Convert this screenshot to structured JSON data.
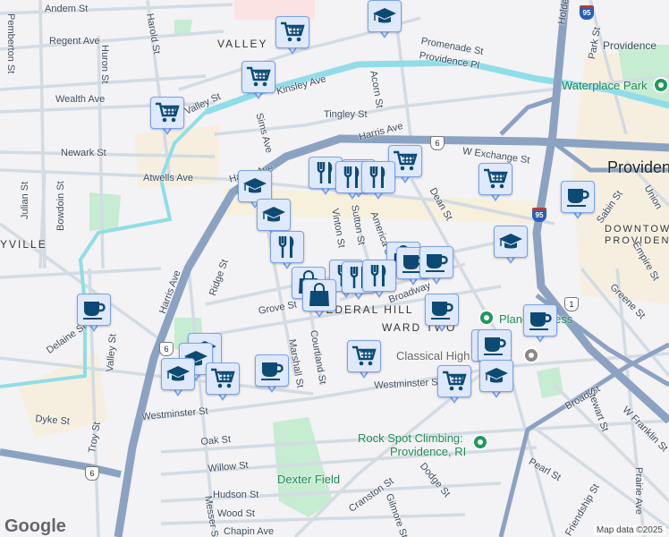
{
  "map": {
    "streets": [
      "Andem St",
      "Harold St",
      "Regent Ave",
      "Pemberton St",
      "Huron St",
      "Wealth Ave",
      "VALLEY",
      "Newark St",
      "Atwells Ave",
      "Julian St",
      "Bowdoin St",
      "YVILLE",
      "Kinsley Ave",
      "Valley St",
      "Sims Ave",
      "Harris Ave",
      "Tingley St",
      "Acorn St",
      "Harris Ave",
      "Promenade St",
      "Providence Pl",
      "W Exchange St",
      "Dean St",
      "Providence",
      "Waterplace Park",
      "Providence",
      "DOWNTOWN",
      "PROVIDENCE",
      "Sabin St",
      "Park St",
      "Empire St",
      "Vinton St",
      "Sutton St",
      "America St",
      "Broadway",
      "FEDERAL HILL",
      "WARD TWO",
      "Grove St",
      "Ridge St",
      "Harris Ave",
      "Delaine St",
      "Valley St",
      "Marshall St",
      "Courtland St",
      "Westminster St",
      "Westminster St",
      "Dyke St",
      "Troy St",
      "Oak St",
      "Willow St",
      "Hudson St",
      "Wood St",
      "Chapin Ave",
      "Messer St",
      "Dexter Field",
      "Classical High School",
      "Planet Fitness",
      "Rock Spot Climbing:",
      "Providence, RI",
      "Cranston St",
      "Dodge St",
      "Gilmore St",
      "Broad St",
      "Stewart St",
      "W Franklin St",
      "Pearl St",
      "Friendship St",
      "Prairie Ave",
      "Greene St",
      "Union",
      "Holden"
    ],
    "shields": {
      "us6": "6",
      "i95": "95",
      "us1": "1"
    },
    "markers": [
      {
        "icon": "grocery-cart"
      },
      {
        "icon": "school"
      },
      {
        "icon": "grocery-cart"
      },
      {
        "icon": "grocery-cart"
      },
      {
        "icon": "grocery-cart"
      },
      {
        "icon": "restaurant"
      },
      {
        "icon": "shopping-bag"
      },
      {
        "icon": "restaurant"
      },
      {
        "icon": "restaurant"
      },
      {
        "icon": "school"
      },
      {
        "icon": "school"
      },
      {
        "icon": "restaurant"
      },
      {
        "icon": "grocery-cart"
      },
      {
        "icon": "coffee"
      },
      {
        "icon": "school"
      },
      {
        "icon": "shopping-bag"
      },
      {
        "icon": "coffee"
      },
      {
        "icon": "coffee"
      },
      {
        "icon": "shopping-bag"
      },
      {
        "icon": "restaurant"
      },
      {
        "icon": "restaurant"
      },
      {
        "icon": "restaurant"
      },
      {
        "icon": "shopping-bag"
      },
      {
        "icon": "coffee"
      },
      {
        "icon": "coffee"
      },
      {
        "icon": "coffee"
      },
      {
        "icon": "coffee"
      },
      {
        "icon": "coffee"
      },
      {
        "icon": "school"
      },
      {
        "icon": "school"
      },
      {
        "icon": "school"
      },
      {
        "icon": "grocery-cart"
      },
      {
        "icon": "coffee"
      },
      {
        "icon": "grocery-cart"
      },
      {
        "icon": "grocery-cart"
      },
      {
        "icon": "school"
      }
    ],
    "google_logo": "Google",
    "attribution": "Map data ©2025"
  }
}
